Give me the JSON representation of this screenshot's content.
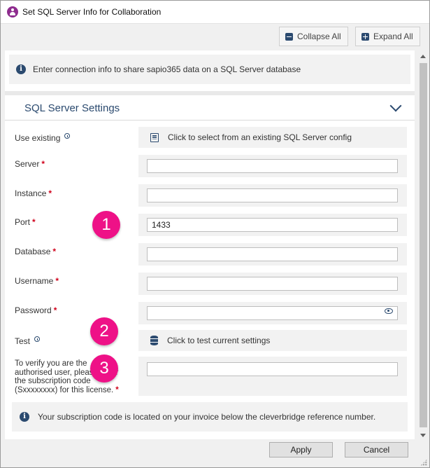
{
  "window": {
    "title": "Set SQL Server Info for Collaboration",
    "accent": "#2b4a6f"
  },
  "toolbar": {
    "collapse_label": "Collapse All",
    "expand_label": "Expand All"
  },
  "info": {
    "text": "Enter connection info to share sapio365 data on a SQL Server database"
  },
  "section": {
    "title": "SQL Server Settings"
  },
  "fields": {
    "use_existing": {
      "label": "Use existing",
      "action": "Click to select from an existing SQL Server config"
    },
    "server": {
      "label": "Server",
      "value": ""
    },
    "instance": {
      "label": "Instance",
      "value": ""
    },
    "port": {
      "label": "Port",
      "value": "1433"
    },
    "database": {
      "label": "Database",
      "value": ""
    },
    "username": {
      "label": "Username",
      "value": ""
    },
    "password": {
      "label": "Password",
      "value": ""
    },
    "test": {
      "label": "Test",
      "action": "Click to test current settings"
    },
    "subscription": {
      "label_lines": [
        "To verify you are the",
        "authorised user, please enter",
        "the subscription code",
        "(Sxxxxxxxx) for this license."
      ],
      "value": ""
    },
    "required_mark": "*"
  },
  "note": {
    "text": "Your subscription code is located on your invoice below the cleverbridge reference number."
  },
  "badges": [
    "1",
    "2",
    "3"
  ],
  "footer": {
    "apply_label": "Apply",
    "cancel_label": "Cancel"
  }
}
